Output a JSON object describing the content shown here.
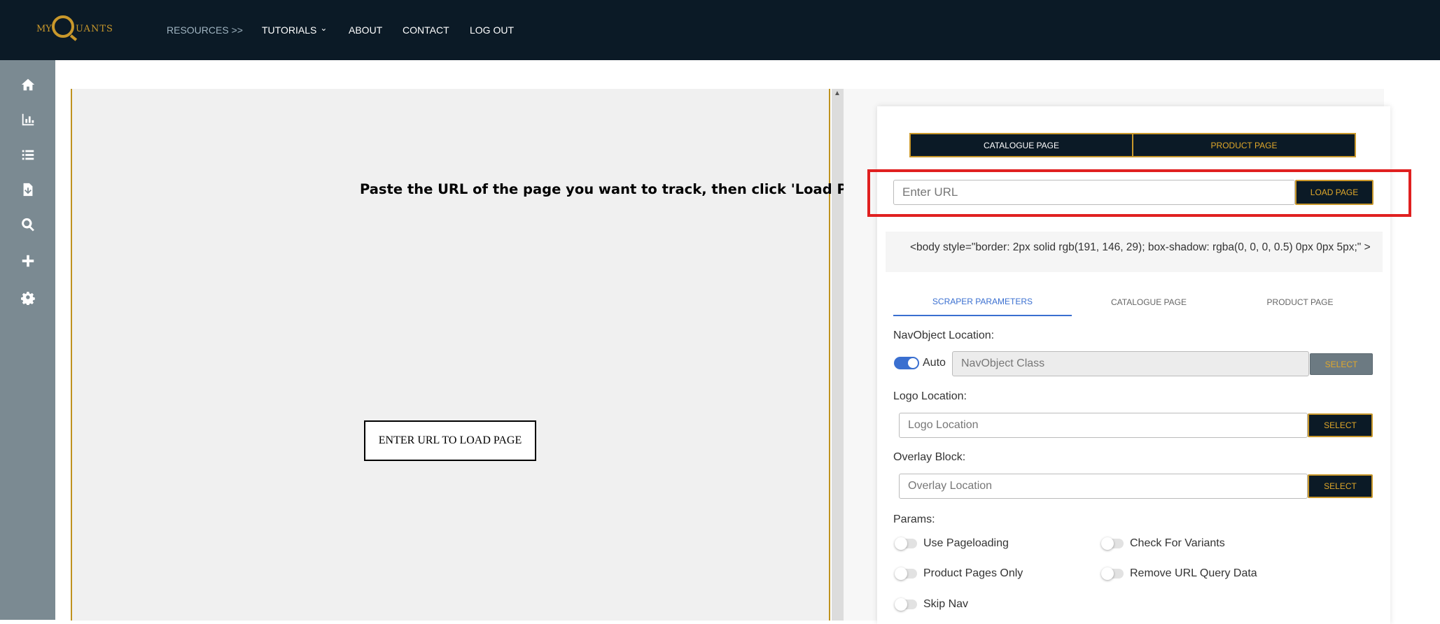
{
  "header": {
    "logo_text_left": "MY",
    "logo_text_right": "UANTS",
    "nav": [
      {
        "label": "RESOURCES >>"
      },
      {
        "label": "TUTORIALS"
      },
      {
        "label": "ABOUT"
      },
      {
        "label": "CONTACT"
      },
      {
        "label": "LOG OUT"
      }
    ],
    "tutorials_chevron": "⌄"
  },
  "sidebar": {
    "icons": [
      "home-icon",
      "bar-chart-icon",
      "list-icon",
      "file-download-icon",
      "search-icon",
      "plus-icon",
      "gear-icon"
    ]
  },
  "preview": {
    "annotation": "Paste the URL of the page you want to track, then click 'Load Page' >>>",
    "placeholder_button": "ENTER URL TO LOAD PAGE",
    "scroll_up": "▲"
  },
  "panel": {
    "page_switch": {
      "catalogue": "CATALOGUE PAGE",
      "product": "PRODUCT PAGE"
    },
    "url": {
      "placeholder": "Enter URL",
      "value": "",
      "button": "LOAD PAGE"
    },
    "code_snippet": "<body style=\"border: 2px solid rgb(191, 146, 29); box-shadow: rgba(0, 0, 0, 0.5) 0px 0px 5px;\" >",
    "tabs": [
      "SCRAPER PARAMETERS",
      "CATALOGUE PAGE",
      "PRODUCT PAGE"
    ],
    "active_tab": "SCRAPER PARAMETERS",
    "navobject": {
      "label": "NavObject Location:",
      "auto_label": "Auto",
      "auto_on": true,
      "placeholder": "NavObject Class",
      "button": "SELECT"
    },
    "logo": {
      "label": "Logo Location:",
      "placeholder": "Logo Location",
      "button": "SELECT"
    },
    "overlay": {
      "label": "Overlay Block:",
      "placeholder": "Overlay Location",
      "button": "SELECT"
    },
    "params": {
      "label": "Params:",
      "toggles": [
        {
          "label": "Use Pageloading",
          "on": false
        },
        {
          "label": "Check For Variants",
          "on": false
        },
        {
          "label": "Product Pages Only",
          "on": false
        },
        {
          "label": "Remove URL Query Data",
          "on": false
        },
        {
          "label": "Skip Nav",
          "on": false
        }
      ]
    }
  },
  "colors": {
    "nav_bg": "#0b1a26",
    "accent_gold": "#c9982b",
    "sidebar_bg": "#7b8a92",
    "highlight_red": "#e02020",
    "active_blue": "#3a6fd0"
  }
}
